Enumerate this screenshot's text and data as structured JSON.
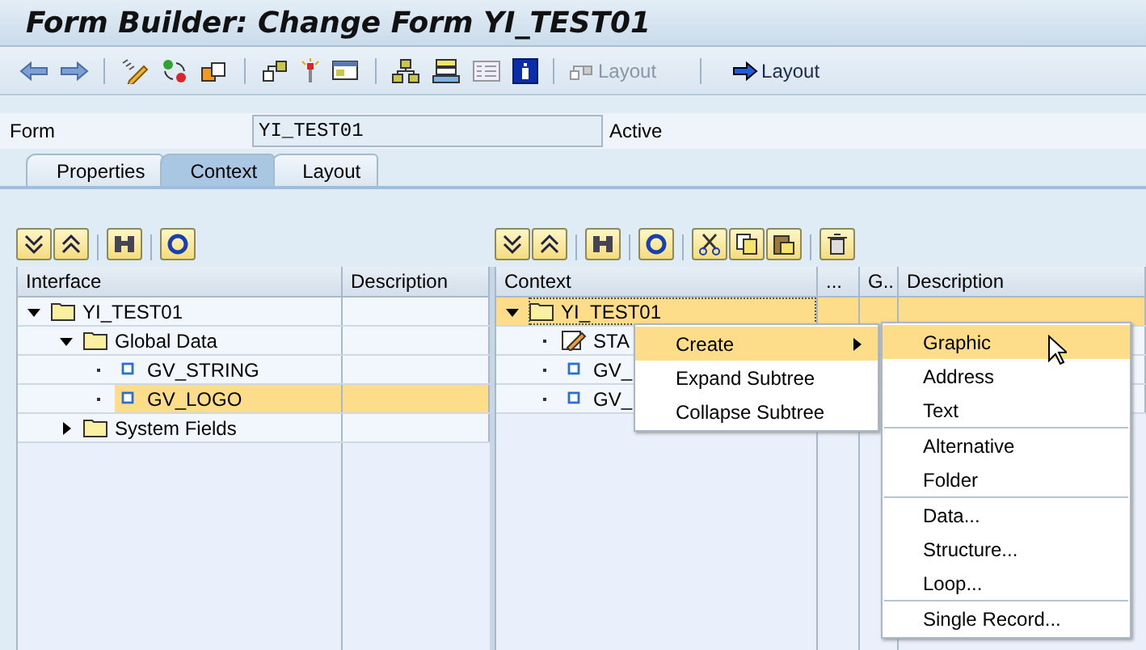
{
  "window": {
    "title": "Form Builder: Change Form YI_TEST01"
  },
  "toolbar": [
    {
      "label": "Layout",
      "disabled": true
    },
    {
      "label": "Layout",
      "disabled": false
    }
  ],
  "form": {
    "label": "Form",
    "value": "YI_TEST01",
    "status": "Active"
  },
  "tabs": [
    {
      "label": "Properties",
      "selected": false
    },
    {
      "label": "Context",
      "selected": true
    },
    {
      "label": "Layout",
      "selected": false
    }
  ],
  "interface_tree": {
    "columns": [
      "Interface",
      "Description"
    ],
    "rows": [
      {
        "label": "YI_TEST01",
        "kind": "folder",
        "expanded": true,
        "selected": false,
        "children": [
          {
            "label": "Global Data",
            "kind": "folder",
            "expanded": true,
            "selected": false,
            "children": [
              {
                "label": "GV_STRING",
                "kind": "variable",
                "selected": false
              },
              {
                "label": "GV_LOGO",
                "kind": "variable",
                "selected": true
              }
            ]
          },
          {
            "label": "System Fields",
            "kind": "folder",
            "expanded": false,
            "selected": false
          }
        ]
      }
    ]
  },
  "context_tree": {
    "columns": [
      "Context",
      "...",
      "G..",
      "Description"
    ],
    "rows": [
      {
        "label": "YI_TEST01",
        "kind": "folder",
        "expanded": true,
        "selected": true,
        "children": [
          {
            "label": "STA",
            "kind": "text",
            "selected": false
          },
          {
            "label": "GV_",
            "kind": "variable",
            "selected": false
          },
          {
            "label": "GV_",
            "kind": "variable",
            "selected": false
          }
        ]
      }
    ]
  },
  "context_menu": {
    "items": [
      {
        "label": "Create",
        "selected": true,
        "submenu": true
      },
      {
        "label": "Expand Subtree",
        "selected": false,
        "submenu": false
      },
      {
        "label": "Collapse Subtree",
        "selected": false,
        "submenu": false
      }
    ]
  },
  "submenu": {
    "groups": [
      [
        {
          "label": "Graphic",
          "selected": true
        },
        {
          "label": "Address",
          "selected": false
        },
        {
          "label": "Text",
          "selected": false
        }
      ],
      [
        {
          "label": "Alternative",
          "selected": false
        },
        {
          "label": "Folder",
          "selected": false
        }
      ],
      [
        {
          "label": "Data...",
          "selected": false
        },
        {
          "label": "Structure...",
          "selected": false
        },
        {
          "label": "Loop...",
          "selected": false
        }
      ],
      [
        {
          "label": "Single Record...",
          "selected": false
        }
      ]
    ]
  }
}
